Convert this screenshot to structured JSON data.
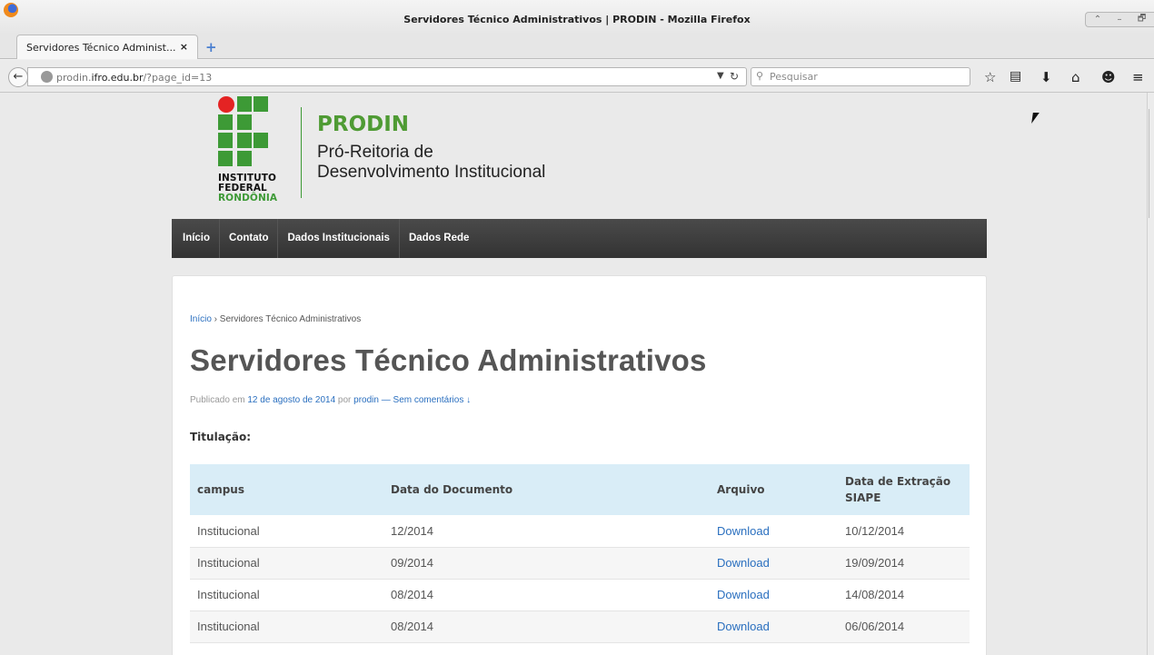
{
  "window": {
    "title": "Servidores Técnico Administrativos | PRODIN - Mozilla Firefox",
    "controls": [
      "⌃",
      "–",
      "🗗"
    ]
  },
  "tabs": [
    {
      "label": "Servidores Técnico Administ...",
      "close": "×"
    }
  ],
  "new_tab": "+",
  "navbar": {
    "url_prefix": "prodin.",
    "url_domain": "ifro.edu.br",
    "url_path": "/?page_id=13",
    "search_placeholder": "Pesquisar",
    "toolbar_icons": [
      "star-icon",
      "reading-list-icon",
      "download-icon",
      "home-icon",
      "chat-icon",
      "menu-icon"
    ]
  },
  "site": {
    "logo_lines": [
      "INSTITUTO",
      "FEDERAL",
      "RONDÔNIA"
    ],
    "brand": "PRODIN",
    "tagline_1": "Pró-Reitoria de",
    "tagline_2": "Desenvolvimento Institucional",
    "nav": [
      "Início",
      "Contato",
      "Dados Institucionais",
      "Dados Rede"
    ]
  },
  "article": {
    "breadcrumb_home": "Início",
    "breadcrumb_sep": " › ",
    "breadcrumb_current": "Servidores Técnico Administrativos",
    "title": "Servidores Técnico Administrativos",
    "meta_published": "Publicado em ",
    "meta_date": "12 de agosto de 2014",
    "meta_by": " por ",
    "meta_author": "prodin",
    "meta_sep": " — ",
    "meta_comments": "Sem comentários ↓",
    "subheading": "Titulação:",
    "table": {
      "headers": [
        "campus",
        "Data do Documento",
        "Arquivo",
        "Data de Extração SIAPE"
      ],
      "rows": [
        [
          "Institucional",
          "12/2014",
          "Download",
          "10/12/2014"
        ],
        [
          "Institucional",
          "09/2014",
          "Download",
          "19/09/2014"
        ],
        [
          "Institucional",
          "08/2014",
          "Download",
          "14/08/2014"
        ],
        [
          "Institucional",
          "08/2014",
          "Download",
          "06/06/2014"
        ]
      ]
    }
  },
  "colors": {
    "brand_green": "#4f9b34",
    "logo_red": "#e42323",
    "link_blue": "#2a6fbf",
    "nav_bg": "#3a3a3a",
    "table_header_bg": "#d9edf7"
  }
}
